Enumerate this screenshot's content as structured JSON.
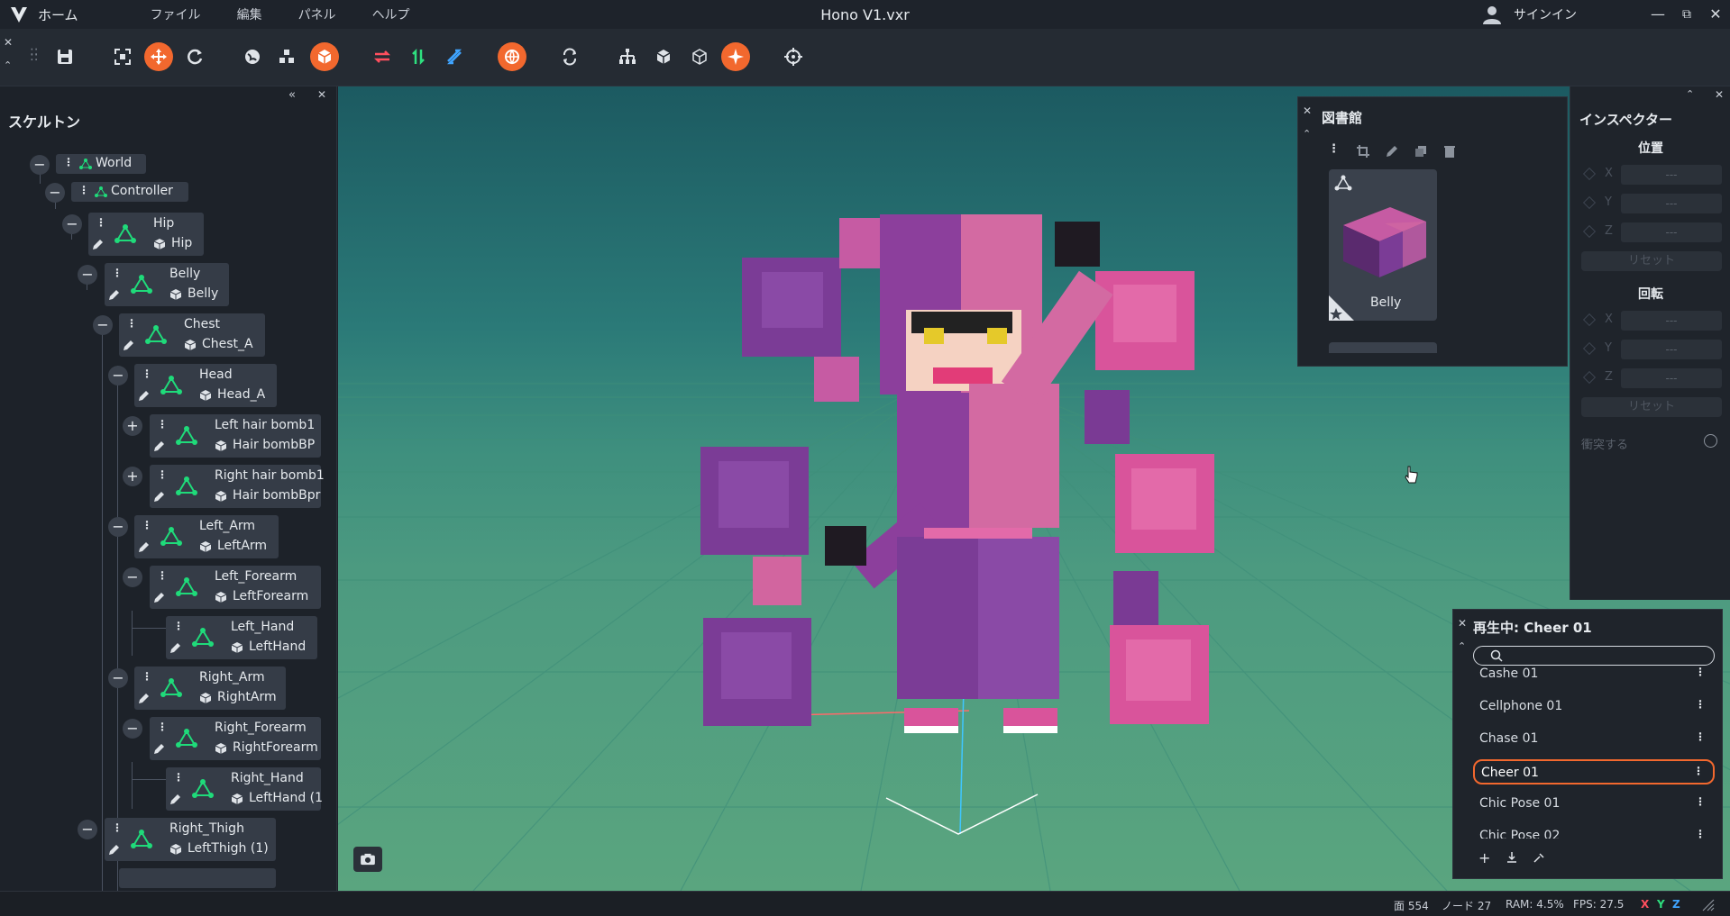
{
  "app": {
    "home_label": "ホーム",
    "menus": [
      "ファイル",
      "編集",
      "パネル",
      "ヘルプ"
    ],
    "document_title": "Hono V1.vxr",
    "signin_label": "サインイン",
    "accent_color": "#f2682e",
    "bone_icon_color": "#1fdb7a"
  },
  "skeleton": {
    "title": "スケルトン",
    "nodes": [
      {
        "bone": "World"
      },
      {
        "bone": "Controller"
      },
      {
        "bone": "Hip",
        "mesh": "Hip"
      },
      {
        "bone": "Belly",
        "mesh": "Belly"
      },
      {
        "bone": "Chest",
        "mesh": "Chest_A"
      },
      {
        "bone": "Head",
        "mesh": "Head_A"
      },
      {
        "bone": "Left hair bomb1",
        "mesh": "Hair bombBP"
      },
      {
        "bone": "Right hair bomb1",
        "mesh": "Hair bombBpr"
      },
      {
        "bone": "Left_Arm",
        "mesh": "LeftArm"
      },
      {
        "bone": "Left_Forearm",
        "mesh": "LeftForearm"
      },
      {
        "bone": "Left_Hand",
        "mesh": "LeftHand"
      },
      {
        "bone": "Right_Arm",
        "mesh": "RightArm"
      },
      {
        "bone": "Right_Forearm",
        "mesh": "RightForearm"
      },
      {
        "bone": "Right_Hand",
        "mesh": "LeftHand (1"
      },
      {
        "bone": "Right_Thigh",
        "mesh": "LeftThigh (1)"
      }
    ]
  },
  "library": {
    "title": "図書館",
    "card_name": "Belly"
  },
  "inspector": {
    "title": "インスペクター",
    "position_label": "位置",
    "rotation_label": "回転",
    "axes": [
      "X",
      "Y",
      "Z"
    ],
    "empty_value": "---",
    "reset_label": "リセット",
    "collision_label": "衝突する"
  },
  "playback": {
    "title": "再生中: Cheer 01",
    "animations": [
      "Cashe 01",
      "Cellphone 01",
      "Chase 01",
      "Cheer 01",
      "Chic Pose 01",
      "Chic Pose 02"
    ],
    "selected": "Cheer 01"
  },
  "status": {
    "faces": "面 554",
    "nodes": "ノード 27",
    "ram": "RAM: 4.5%",
    "fps": "FPS: 27.5",
    "axis_x": "X",
    "axis_y": "Y",
    "axis_z": "Z"
  }
}
